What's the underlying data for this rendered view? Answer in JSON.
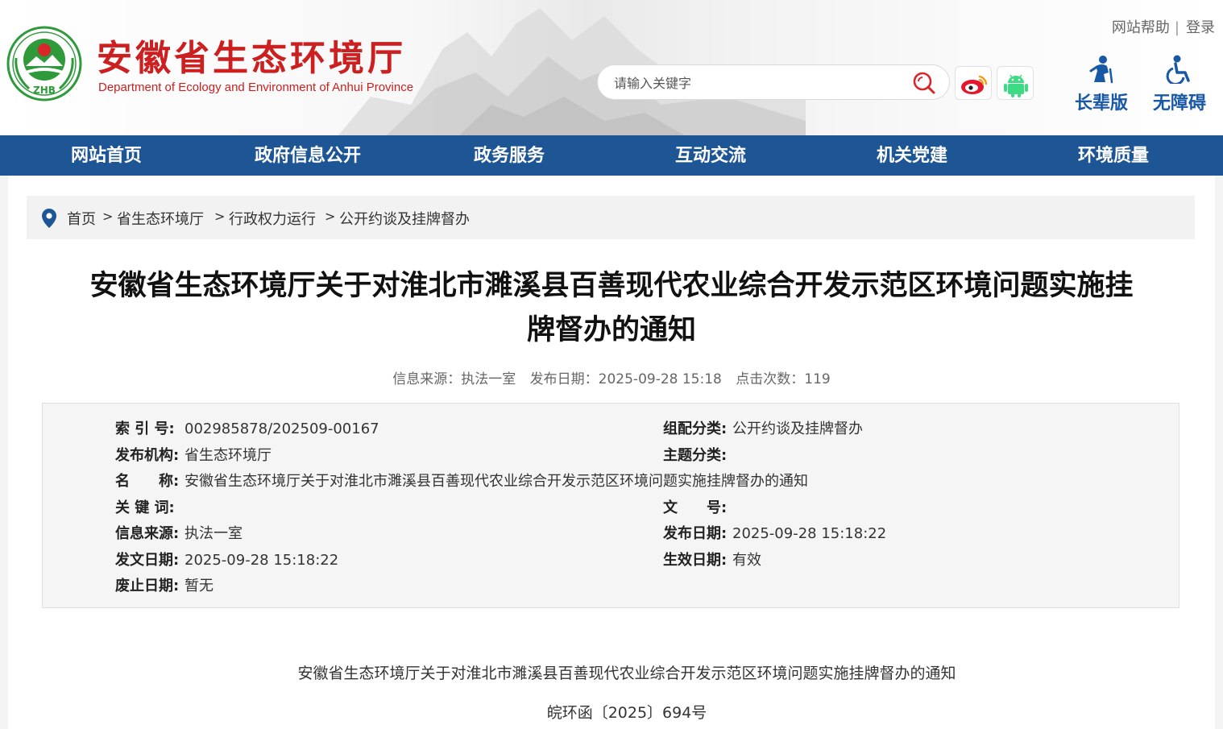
{
  "header": {
    "logo_text": "ZHB",
    "site_title": "安徽省生态环境厅",
    "site_subtitle": "Department of Ecology and Environment of Anhui Province",
    "top_links": [
      "网站帮助",
      "登录"
    ],
    "search": {
      "placeholder": "请输入关键字"
    },
    "social_icons": [
      "weibo-icon",
      "android-icon"
    ],
    "accessibility": [
      {
        "label": "长辈版",
        "icon": "elderly-person-icon"
      },
      {
        "label": "无障碍",
        "icon": "wheelchair-icon"
      }
    ],
    "colors": {
      "title": "#cc1f1f",
      "access": "#1958a5"
    }
  },
  "nav": {
    "items": [
      "网站首页",
      "政府信息公开",
      "政务服务",
      "互动交流",
      "机关党建",
      "环境质量"
    ],
    "color": "#1e5594"
  },
  "breadcrumb": {
    "items": [
      "首页",
      "省生态环境厅",
      "行政权力运行",
      "公开约谈及挂牌督办"
    ],
    "separator": ">"
  },
  "article": {
    "title_line1": "安徽省生态环境厅关于对淮北市濉溪县百善现代农业综合开发示范区环境问题实施挂",
    "title_line2": "牌督办的通知",
    "meta": {
      "source": "信息来源：执法一室",
      "date": "发布日期：2025-09-28 15:18",
      "hits": "点击次数：119"
    }
  },
  "info": {
    "index_no": {
      "label": "索 引 号:",
      "value": "002985878/202509-00167"
    },
    "category": {
      "label": "组配分类:",
      "value": "公开约谈及挂牌督办"
    },
    "publisher": {
      "label": "发布机构:",
      "value": "省生态环境厅"
    },
    "topic": {
      "label": "主题分类:",
      "value": ""
    },
    "name": {
      "label": "名　　称:",
      "value": "安徽省生态环境厅关于对淮北市濉溪县百善现代农业综合开发示范区环境问题实施挂牌督办的通知"
    },
    "keywords": {
      "label": "关 键 词:",
      "value": ""
    },
    "doc_no": {
      "label": "文　　号:",
      "value": ""
    },
    "source": {
      "label": "信息来源:",
      "value": "执法一室"
    },
    "pub_date": {
      "label": "发布日期:",
      "value": "2025-09-28 15:18:22"
    },
    "issue_date": {
      "label": "发文日期:",
      "value": "2025-09-28 15:18:22"
    },
    "effective": {
      "label": "生效日期:",
      "value": "有效"
    },
    "repeal": {
      "label": "废止日期:",
      "value": "暂无"
    }
  },
  "body": {
    "heading": "安徽省生态环境厅关于对淮北市濉溪县百善现代农业综合开发示范区环境问题实施挂牌督办的通知",
    "doc_number": "皖环函〔2025〕694号"
  }
}
